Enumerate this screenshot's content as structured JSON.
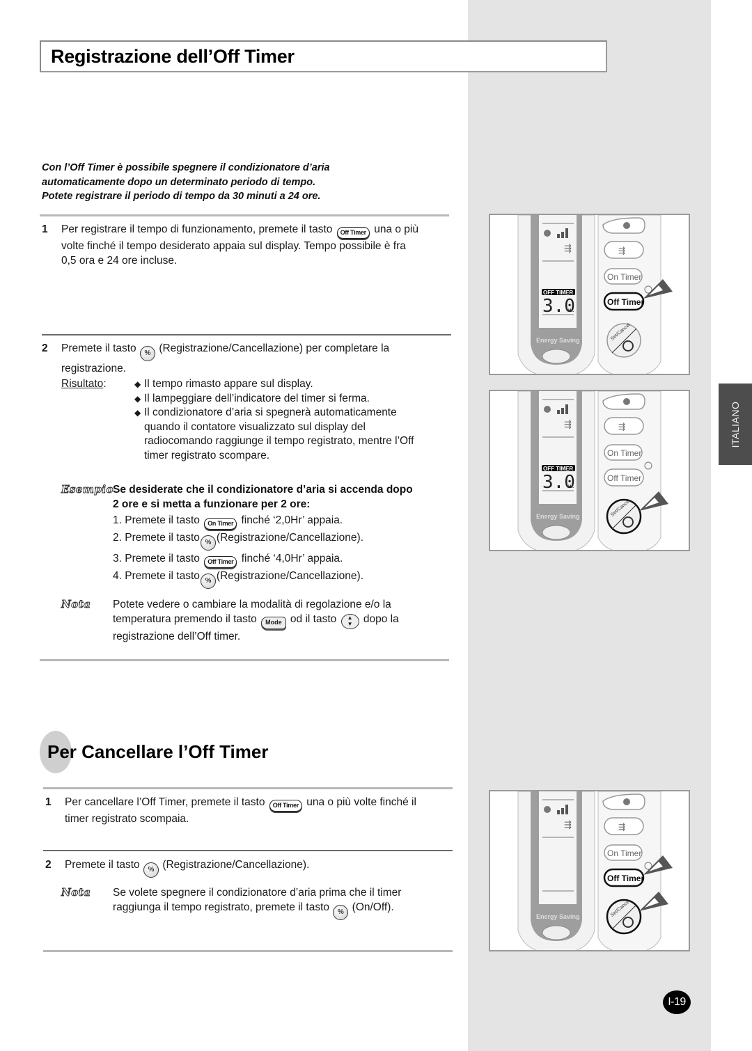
{
  "page": {
    "title": "Registrazione dell’Off Timer",
    "intro_lines": [
      "Con l’Off Timer è possibile spegnere il condizionatore d’aria",
      "automaticamente dopo un determinato periodo di tempo.",
      "Potete registrare il periodo di tempo da 30 minuti a 24 ore."
    ],
    "language_tab": "ITALIANO",
    "page_number": "I-19"
  },
  "buttons": {
    "off_timer": "Off Timer",
    "on_timer": "On Timer",
    "set_cancel_glyph": "%",
    "mode": "Mode",
    "up_down_up": "▲",
    "up_down_down": "▼"
  },
  "section1": {
    "step1": {
      "number": "1",
      "before": "Per registrare il tempo di funzionamento, premete il tasto",
      "after": "una o più",
      "line2": "volte finché il tempo desiderato appaia sul display. Tempo possibile è fra",
      "line3": "0,5 ora e 24 ore incluse."
    },
    "step2": {
      "number": "2",
      "before": "Premete il tasto",
      "after": "(Registrazione/Cancellazione) per completare la",
      "line2": "registrazione."
    },
    "result": {
      "label": "Risultato",
      "colon": ":",
      "bullets": [
        "Il tempo rimasto appare sul display.",
        "Il lampeggiare dell’indicatore del timer si ferma.",
        "Il condizionatore d’aria si spegnerà automaticamente quando il contatore visualizzato sul display del radiocomando raggiunge il tempo registrato, mentre l’Off timer registrato scompare."
      ],
      "bullet_glyph": "◆"
    },
    "example": {
      "tag": "Esempio",
      "title_line1": "Se desiderate che il condizionatore d’aria si accenda dopo",
      "title_line2": "2 ore e si metta a funzionare per 2 ore:",
      "steps": [
        {
          "prefix": "1. Premete il tasto",
          "button": "On Timer",
          "suffix": "finché ‘2,0Hr’ appaia."
        },
        {
          "prefix": "2. Premete il tasto",
          "button": "set-cancel",
          "suffix": "(Registrazione/Cancellazione)."
        },
        {
          "prefix": "3. Premete il tasto",
          "button": "Off Timer",
          "suffix": "finché ‘4,0Hr’ appaia."
        },
        {
          "prefix": "4. Premete il tasto",
          "button": "set-cancel",
          "suffix": "(Registrazione/Cancellazione)."
        }
      ]
    },
    "note": {
      "tag": "Nota",
      "line1": "Potete vedere o cambiare la modalità di regolazione e/o la",
      "line2_a": "temperatura premendo il tasto",
      "line2_b": "od il tasto",
      "line2_c": "dopo la",
      "line3": "registrazione dell’Off timer."
    }
  },
  "section2": {
    "title": "Per Cancellare l’Off Timer",
    "step1": {
      "number": "1",
      "before": "Per cancellare l’Off Timer, premete il tasto",
      "after": "una o più volte finché il",
      "line2": "timer registrato scompaia."
    },
    "step2": {
      "number": "2",
      "before": "Premete il tasto",
      "after": "(Registrazione/Cancellazione)."
    },
    "note": {
      "tag": "Nota",
      "line1": "Se volete spegnere il condizionatore d’aria prima che il timer",
      "line2_a": "raggiunga il tempo registrato, premete il tasto",
      "line2_b": "(On/Off)."
    }
  },
  "remotes": [
    {
      "display_label": "OFF TIMER",
      "display_value": "3.0",
      "display_unit": "Hr.",
      "energy_label": "Energy Saving",
      "btn_on": "On Timer",
      "btn_off": "Off Timer",
      "set_text": "Set/Cancel",
      "highlighted": "off_timer"
    },
    {
      "display_label": "OFF TIMER",
      "display_value": "3.0",
      "display_unit": "Hr.",
      "energy_label": "Energy Saving",
      "btn_on": "On Timer",
      "btn_off": "Off Timer",
      "set_text": "Set/Cancel",
      "highlighted": "set_cancel"
    },
    {
      "display_label": "",
      "display_value": "",
      "display_unit": "",
      "energy_label": "Energy Saving",
      "btn_on": "On Timer",
      "btn_off": "Off Timer",
      "set_text": "Set/Cancel",
      "highlighted": "both"
    }
  ]
}
